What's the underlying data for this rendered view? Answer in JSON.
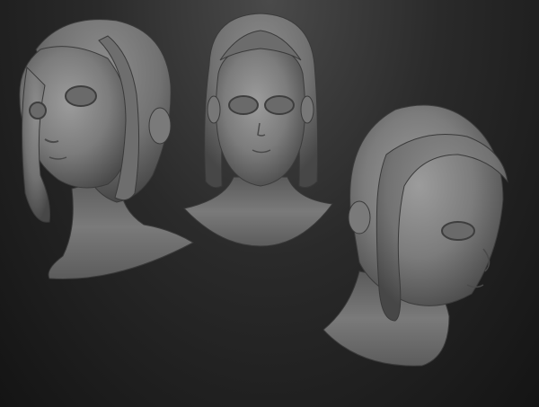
{
  "viewport": {
    "background_top": "#4a4a4a",
    "background_bottom": "#141414"
  },
  "models": [
    {
      "view": "three-quarter-left",
      "label_icon": "head-sculpt-icon"
    },
    {
      "view": "front",
      "label_icon": "head-sculpt-icon"
    },
    {
      "view": "three-quarter-right",
      "label_icon": "head-sculpt-icon"
    }
  ],
  "colors": {
    "clay_light": "#9a9a9a",
    "clay_mid": "#7a7a7a",
    "clay_dark": "#4e4e4e",
    "clay_shadow": "#333333"
  }
}
